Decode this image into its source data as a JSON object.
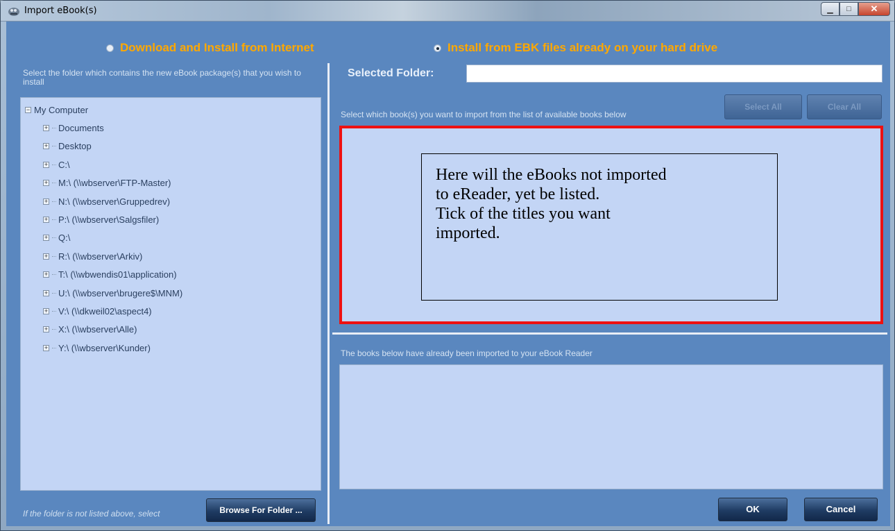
{
  "window": {
    "title": "Import eBook(s)"
  },
  "source_options": {
    "internet_label": "Download and Install from Internet",
    "internet_selected": false,
    "local_label": "Install from EBK files already on your hard drive",
    "local_selected": true
  },
  "folder_pane": {
    "hint": "Select the folder which contains the new eBook package(s) that you wish to install",
    "tree_root": "My Computer",
    "tree_items": [
      "Documents",
      "Desktop",
      "C:\\",
      "M:\\ (\\\\wbserver\\FTP-Master)",
      "N:\\ (\\\\wbserver\\Gruppedrev)",
      "P:\\ (\\\\wbserver\\Salgsfiler)",
      "Q:\\",
      "R:\\ (\\\\wbserver\\Arkiv)",
      "T:\\ (\\\\wbwendis01\\application)",
      "U:\\ (\\\\wbserver\\brugere$\\MNM)",
      "V:\\ (\\\\dkweil02\\aspect4)",
      "X:\\ (\\\\wbserver\\Alle)",
      "Y:\\ (\\\\wbserver\\Kunder)"
    ],
    "browse_hint": "If the folder is not listed above, select",
    "browse_button": "Browse For Folder ..."
  },
  "selected_folder": {
    "label": "Selected Folder:",
    "value": ""
  },
  "available_books": {
    "hint": "Select which book(s) you want to import from the list of available books below",
    "select_all_label": "Select All",
    "clear_all_label": "Clear All",
    "note_line1": "Here will the eBooks not imported",
    "note_line2": "to eReader, yet be listed.",
    "note_line3": "Tick of the titles you want",
    "note_line4": "imported.",
    "highlight_color": "#ee1111"
  },
  "imported_books": {
    "hint": "The books below have already been imported to your eBook Reader"
  },
  "footer": {
    "ok_label": "OK",
    "cancel_label": "Cancel"
  },
  "colors": {
    "panel_bg": "#5a87bf",
    "list_bg": "#c3d5f5",
    "radio_text": "#ffa800"
  }
}
